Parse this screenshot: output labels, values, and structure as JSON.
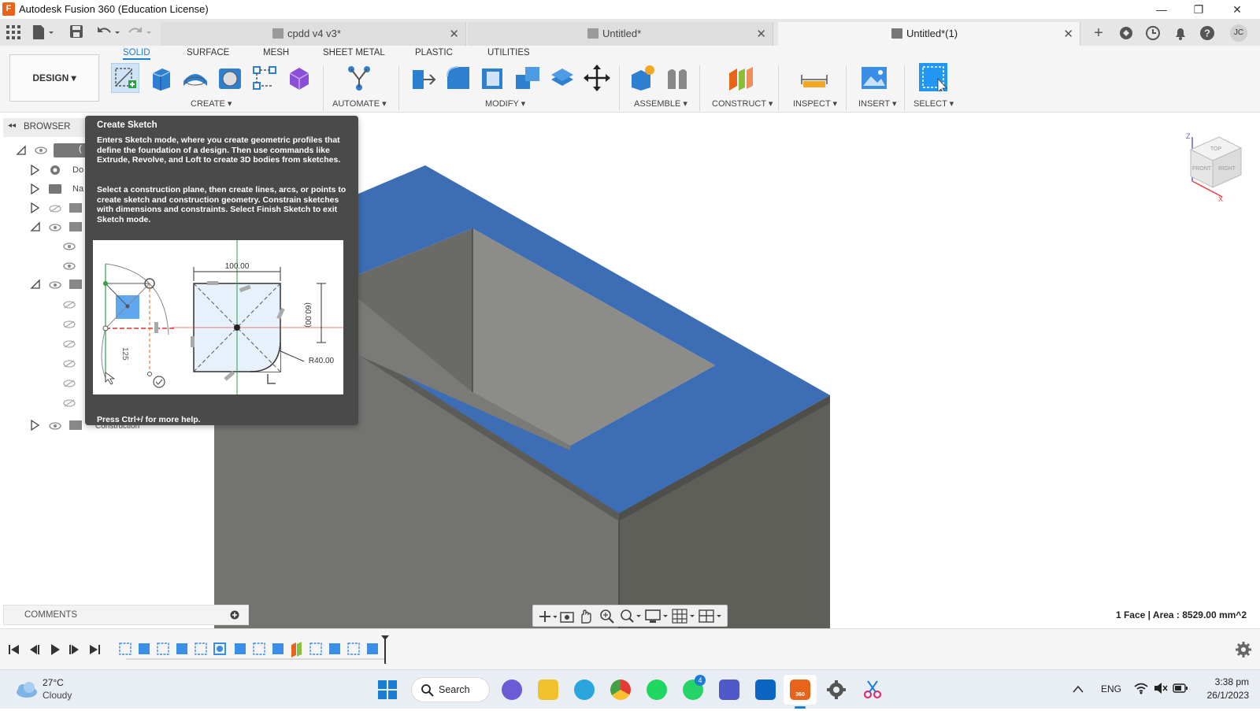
{
  "window": {
    "title": "Autodesk Fusion 360 (Education License)",
    "logo_letter": "F",
    "min": "—",
    "restore": "❐",
    "close": "✕"
  },
  "tabs": [
    {
      "label": "cpdd v4 v3*",
      "close": "✕"
    },
    {
      "label": "Untitled*",
      "close": "✕"
    },
    {
      "label": "Untitled*(1)",
      "close": "✕"
    }
  ],
  "user_initials": "JC",
  "workspace": {
    "label": "DESIGN ▾"
  },
  "ribbon_tabs": [
    "SOLID",
    "SURFACE",
    "MESH",
    "SHEET METAL",
    "PLASTIC",
    "UTILITIES"
  ],
  "ribbon_groups": {
    "create": "CREATE ▾",
    "automate": "AUTOMATE ▾",
    "modify": "MODIFY ▾",
    "assemble": "ASSEMBLE ▾",
    "construct": "CONSTRUCT ▾",
    "inspect": "INSPECT ▾",
    "insert": "INSERT ▾",
    "select": "SELECT ▾"
  },
  "browser": {
    "title": "BROWSER",
    "items": {
      "root": "(",
      "doc_settings": "Do",
      "named_views": "Na",
      "construction": "Construction"
    }
  },
  "tooltip": {
    "title": "Create Sketch",
    "p1": "Enters Sketch mode, where you create geometric profiles that define the foundation of a design. Then use commands like Extrude, Revolve, and Loft to create 3D bodies from sketches.",
    "p2": "Select a construction plane, then create lines, arcs, or points to create sketch and construction geometry. Constrain sketches with dimensions and constraints. Select Finish Sketch to exit Sketch mode.",
    "help": "Press Ctrl+/ for more help.",
    "dim_width": "100.00",
    "dim_height": "(60.00)",
    "dim_radius": "R40.00",
    "dim_left": "125"
  },
  "viewcube": {
    "top": "TOP",
    "front": "FRONT",
    "right": "RIGHT",
    "z": "Z",
    "x": "X"
  },
  "comments": {
    "label": "COMMENTS"
  },
  "status": "1 Face | Area : 8529.00 mm^2",
  "taskbar": {
    "temp": "27°C",
    "weather": "Cloudy",
    "search": "Search",
    "lang": "ENG",
    "time": "3:38 pm",
    "date": "26/1/2023",
    "whatsapp_badge": "4",
    "fusion_label": "360"
  },
  "colors": {
    "accent": "#1a7fd4",
    "face_blue": "#3d6db5",
    "body_gray": "#6d6d68",
    "fusion_orange": "#e8641b"
  }
}
